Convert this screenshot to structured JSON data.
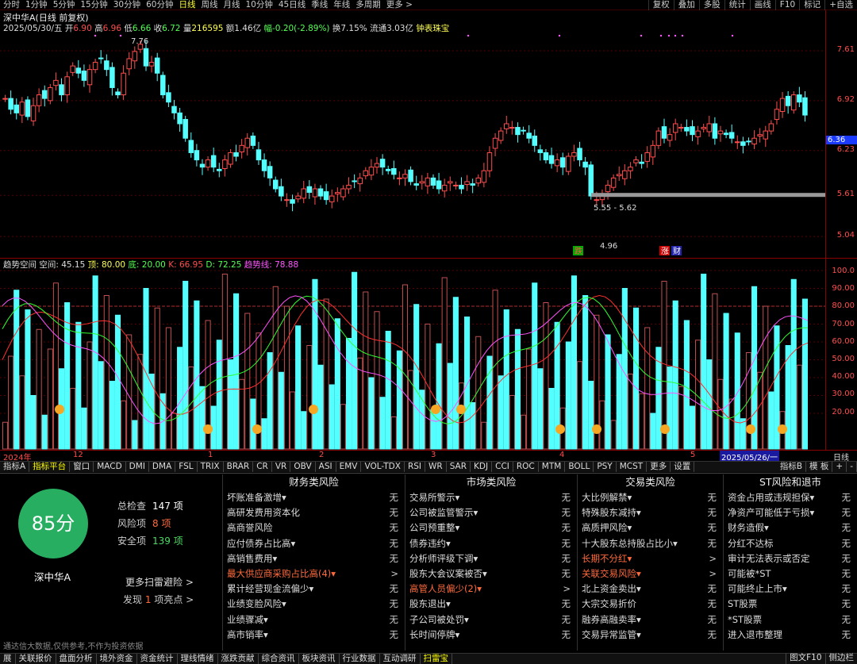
{
  "toolbar": {
    "timeframes": [
      "分时",
      "1分钟",
      "5分钟",
      "15分钟",
      "30分钟",
      "60分钟",
      "日线",
      "周线",
      "月线",
      "10分钟",
      "45日线",
      "季线",
      "年线",
      "多周期",
      "更多 >"
    ],
    "active_timeframe": "日线",
    "tools": [
      "复权",
      "叠加",
      "多股",
      "统计",
      "画线",
      "F10",
      "标记",
      "+自选"
    ]
  },
  "header": {
    "title": "深中华A(日线 前复权)",
    "date": "2025/05/30/五",
    "open_label": "开",
    "open": "6.90",
    "high_label": "高",
    "high": "6.96",
    "low_label": "低",
    "low": "6.66",
    "close_label": "收",
    "close": "6.72",
    "vol_label": "量",
    "volume": "216595",
    "amount": "额1.46亿",
    "change": "幅-0.20(-2.89%)",
    "turnover": "换7.15%",
    "float": "流通3.03亿",
    "tool": "钟表珠宝"
  },
  "price_axis": [
    {
      "label": "7.61",
      "value": 7.61
    },
    {
      "label": "6.92",
      "value": 6.92
    },
    {
      "label": "6.23",
      "value": 6.23
    },
    {
      "label": "5.61",
      "value": 5.61
    },
    {
      "label": "5.04",
      "value": 5.04
    }
  ],
  "current_price_tag": "6.36",
  "annotations": {
    "high_mark": "7.76",
    "low_mark": "4.96",
    "range_mark": "5.55 - 5.62",
    "tag_fall": "跌",
    "tag_rise": "涨",
    "tag_fin": "财"
  },
  "indicator": {
    "name": "趋势空间",
    "label_space": "空间: 45.15",
    "label_top": "顶: 80.00",
    "label_bottom": "底: 20.00",
    "label_k": "K: 66.95",
    "label_d": "D: 72.25",
    "label_trend": "趋势线: 78.88",
    "axis": [
      "100.0",
      "90.00",
      "80.00",
      "70.00",
      "60.00",
      "50.00",
      "40.00",
      "30.00",
      "20.00"
    ]
  },
  "date_axis": {
    "labels": [
      "2024年",
      "12",
      "1",
      "2",
      "3",
      "4",
      "5"
    ],
    "current": "2025/05/26/一",
    "period": "日线"
  },
  "indicator_tabs": [
    "指标A",
    "指标平台",
    "窗口",
    "MACD",
    "DMI",
    "DMA",
    "FSL",
    "TRIX",
    "BRAR",
    "CR",
    "VR",
    "OBV",
    "ASI",
    "EMV",
    "VOL-TDX",
    "RSI",
    "WR",
    "SAR",
    "KDJ",
    "CCI",
    "ROC",
    "MTM",
    "BOLL",
    "PSY",
    "MCST",
    "更多",
    "设置"
  ],
  "indicator_tabs_right": [
    "指标B",
    "模 板",
    "+",
    "-"
  ],
  "risk": {
    "score": "85分",
    "stock_name": "深中华A",
    "total_label": "总检查",
    "total": "147 项",
    "risk_label": "风险项",
    "risk_count": "8 项",
    "safe_label": "安全项",
    "safe_count": "139 项",
    "more_link": "更多扫雷避险 >",
    "find_pre": "发现",
    "find_count": "1",
    "find_post": "项亮点 >",
    "columns": [
      {
        "title": "财务类风险",
        "items": [
          {
            "label": "坏账准备激增▾",
            "status": "无",
            "hl": false
          },
          {
            "label": "高研发费用资本化",
            "status": "无",
            "hl": false
          },
          {
            "label": "高商誉风险",
            "status": "无",
            "hl": false
          },
          {
            "label": "应付债券占比高▾",
            "status": "无",
            "hl": false
          },
          {
            "label": "高销售费用▾",
            "status": "无",
            "hl": false
          },
          {
            "label": "最大供应商采购占比高(4)▾",
            "status": ">",
            "hl": true
          },
          {
            "label": "累计经营现金流偏少▾",
            "status": "无",
            "hl": false
          },
          {
            "label": "业绩变脸风险▾",
            "status": "无",
            "hl": false
          },
          {
            "label": "业绩骤减▾",
            "status": "无",
            "hl": false
          },
          {
            "label": "高市销率▾",
            "status": "无",
            "hl": false
          }
        ]
      },
      {
        "title": "市场类风险",
        "items": [
          {
            "label": "交易所警示▾",
            "status": "无",
            "hl": false
          },
          {
            "label": "公司被监管警示▾",
            "status": "无",
            "hl": false
          },
          {
            "label": "公司预重整▾",
            "status": "无",
            "hl": false
          },
          {
            "label": "债券违约▾",
            "status": "无",
            "hl": false
          },
          {
            "label": "分析师评级下调▾",
            "status": "无",
            "hl": false
          },
          {
            "label": "股东大会议案被否▾",
            "status": "无",
            "hl": false
          },
          {
            "label": "高管人员偏少(2)▾",
            "status": ">",
            "hl": true
          },
          {
            "label": "股东退出▾",
            "status": "无",
            "hl": false
          },
          {
            "label": "子公司被处罚▾",
            "status": "无",
            "hl": false
          },
          {
            "label": "长时间停牌▾",
            "status": "无",
            "hl": false
          }
        ]
      },
      {
        "title": "交易类风险",
        "items": [
          {
            "label": "大比例解禁▾",
            "status": "无",
            "hl": false
          },
          {
            "label": "特殊股东减持▾",
            "status": "无",
            "hl": false
          },
          {
            "label": "高质押风险▾",
            "status": "无",
            "hl": false
          },
          {
            "label": "十大股东总持股占比小▾",
            "status": "无",
            "hl": false
          },
          {
            "label": "长期不分红▾",
            "status": ">",
            "hl": true
          },
          {
            "label": "关联交易风险▾",
            "status": ">",
            "hl": true
          },
          {
            "label": "北上资金卖出▾",
            "status": "无",
            "hl": false
          },
          {
            "label": "大宗交易折价",
            "status": "无",
            "hl": false
          },
          {
            "label": "融券高融卖率▾",
            "status": "无",
            "hl": false
          },
          {
            "label": "交易异常监管▾",
            "status": "无",
            "hl": false
          }
        ]
      },
      {
        "title": "ST风险和退市",
        "items": [
          {
            "label": "资金占用或违规担保▾",
            "status": "无",
            "hl": false
          },
          {
            "label": "净资产可能低于亏损▾",
            "status": "无",
            "hl": false
          },
          {
            "label": "财务造假▾",
            "status": "无",
            "hl": false
          },
          {
            "label": "分红不达标",
            "status": "无",
            "hl": false
          },
          {
            "label": "审计无法表示或否定",
            "status": "无",
            "hl": false
          },
          {
            "label": "可能被*ST",
            "status": "无",
            "hl": false
          },
          {
            "label": "可能终止上市▾",
            "status": "无",
            "hl": false
          },
          {
            "label": "ST股票",
            "status": "无",
            "hl": false
          },
          {
            "label": "*ST股票",
            "status": "无",
            "hl": false
          },
          {
            "label": "进入退市整理",
            "status": "无",
            "hl": false
          }
        ]
      }
    ]
  },
  "disclaimer": "通达信大数据,仅供参考,不作为投资依据",
  "bottom_tabs": [
    "展",
    "关联报价",
    "盘面分析",
    "境外资金",
    "资金统计",
    "理线情绪",
    "涨跌贡献",
    "综合资讯",
    "板块资讯",
    "行业数据",
    "互动调研",
    "扫雷宝"
  ],
  "bottom_active": "扫雷宝",
  "bottom_right": [
    "图文F10",
    "侧边栏"
  ],
  "colors": {
    "up": "#ff4d4d",
    "down": "#54ffff",
    "bg": "#000000",
    "score": "#27ae60"
  }
}
